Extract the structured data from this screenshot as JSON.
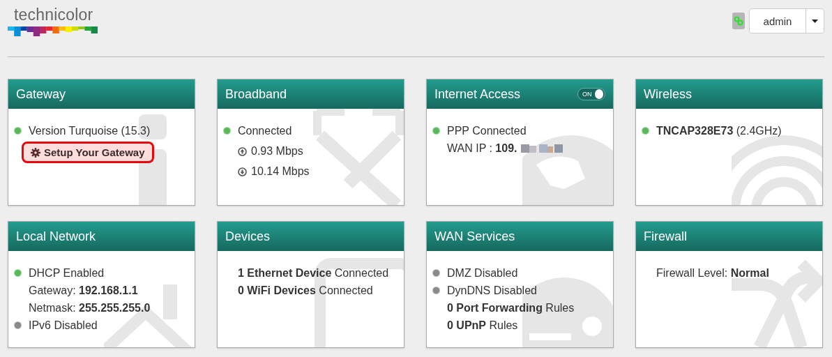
{
  "header": {
    "logo_text": "technicolor",
    "user_button": "admin"
  },
  "cards": [
    {
      "title": "Gateway",
      "lines": [
        {
          "kind": "status",
          "active": true,
          "text": "Version Turquoise (15.3)"
        },
        {
          "kind": "action",
          "highlighted": true,
          "text": "Setup Your Gateway"
        }
      ]
    },
    {
      "title": "Broadband",
      "lines": [
        {
          "kind": "status",
          "active": true,
          "text": "Connected"
        },
        {
          "kind": "speed",
          "upload": true,
          "text": "0.93 Mbps"
        },
        {
          "kind": "speed",
          "upload": false,
          "text": "10.14 Mbps"
        }
      ]
    },
    {
      "title": "Internet Access",
      "toggle": {
        "label": "ON",
        "on": true
      },
      "lines": [
        {
          "kind": "status",
          "active": true,
          "text": "PPP Connected"
        },
        {
          "kind": "masked",
          "text": "WAN IP : **109.**"
        }
      ]
    },
    {
      "title": "Wireless",
      "lines": [
        {
          "kind": "status",
          "active": true,
          "text": "**TNCAP328E73** (2.4GHz)"
        }
      ]
    },
    {
      "title": "Local Network",
      "lines": [
        {
          "kind": "status",
          "active": true,
          "text": "DHCP Enabled"
        },
        {
          "kind": "plain",
          "text": "Gateway: **192.168.1.1**"
        },
        {
          "kind": "plain",
          "text": "Netmask: **255.255.255.0**"
        },
        {
          "kind": "status",
          "active": false,
          "text": "IPv6 Disabled"
        }
      ]
    },
    {
      "title": "Devices",
      "lines": [
        {
          "kind": "plain",
          "text": "**1 Ethernet Device** Connected"
        },
        {
          "kind": "plain",
          "text": "**0 WiFi Devices** Connected"
        }
      ]
    },
    {
      "title": "WAN Services",
      "lines": [
        {
          "kind": "status",
          "active": false,
          "text": "DMZ Disabled"
        },
        {
          "kind": "status",
          "active": false,
          "text": "DynDNS Disabled"
        },
        {
          "kind": "plain",
          "text": "**0 Port Forwarding** Rules"
        },
        {
          "kind": "plain",
          "text": "**0 UPnP** Rules"
        }
      ]
    },
    {
      "title": "Firewall",
      "lines": [
        {
          "kind": "plain",
          "text": "Firewall Level: **Normal**"
        }
      ]
    }
  ]
}
